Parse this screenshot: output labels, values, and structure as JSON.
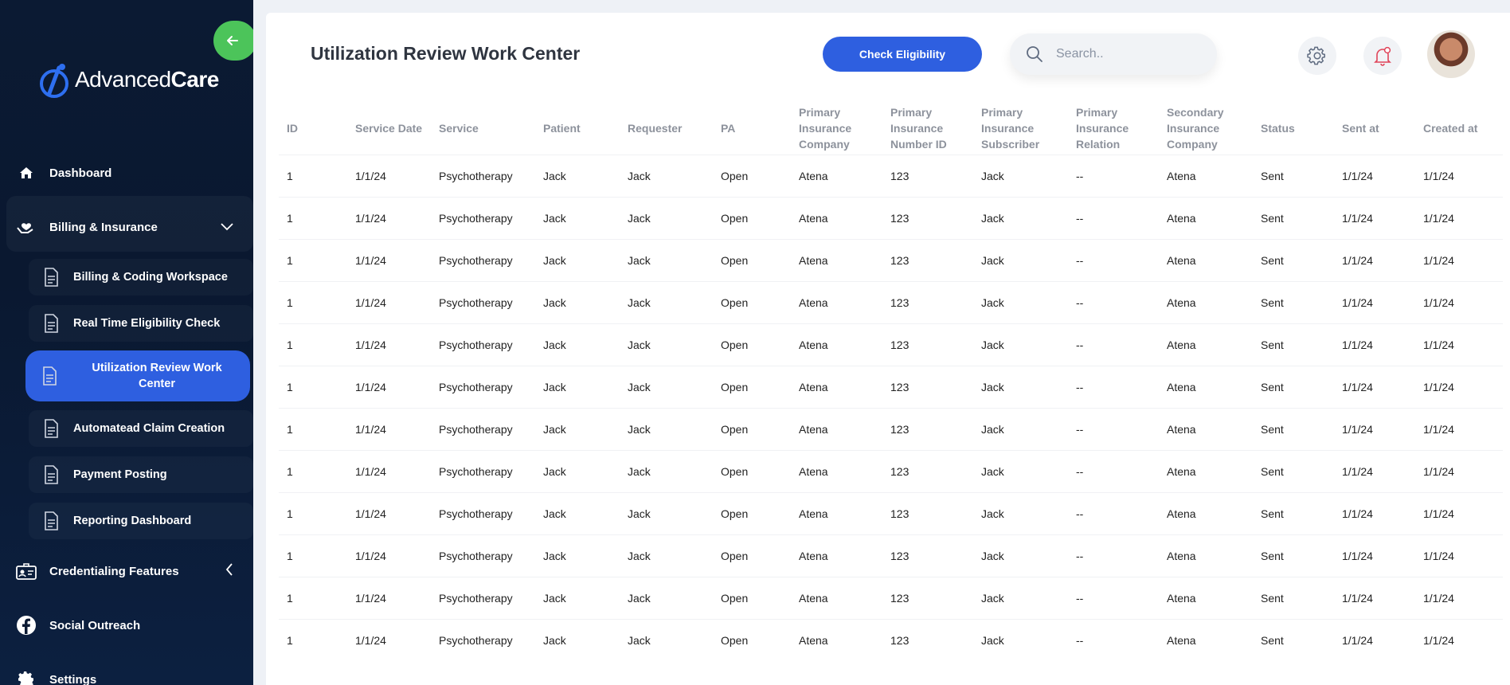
{
  "brand": {
    "name_regular": "Advanced",
    "name_bold": "Care"
  },
  "sidebar": {
    "items": [
      {
        "label": "Dashboard",
        "icon": "home-icon"
      },
      {
        "label": "Billing & Insurance",
        "icon": "hand-heart-icon"
      },
      {
        "label": "Credentialing Features",
        "icon": "id-card-icon"
      },
      {
        "label": "Social Outreach",
        "icon": "facebook-icon"
      },
      {
        "label": "Settings",
        "icon": "gear-icon"
      }
    ],
    "billing_subitems": [
      {
        "label": "Billing & Coding Workspace"
      },
      {
        "label": "Real Time Eligibility Check"
      },
      {
        "label": "Utilization Review Work Center",
        "active": true
      },
      {
        "label": "Automatead Claim Creation"
      },
      {
        "label": "Payment Posting"
      },
      {
        "label": "Reporting Dashboard"
      }
    ]
  },
  "header": {
    "title": "Utilization Review Work Center",
    "check_button": "Check Eligibility",
    "search_placeholder": "Search.."
  },
  "colors": {
    "accent": "#2e5fe0",
    "collapse": "#4cc45a",
    "sidebar_bg": "#0b1a33",
    "bell": "#e0455a"
  },
  "table": {
    "headers": [
      "ID",
      "Service Date",
      "Service",
      "Patient",
      "Requester",
      "PA",
      "Primary Insurance Company",
      "Primary Insurance Number ID",
      "Primary Insurance Subscriber",
      "Primary Insurance Relation",
      "Secondary Insurance Company",
      "Status",
      "Sent at",
      "Created at"
    ],
    "rows": [
      [
        "1",
        "1/1/24",
        "Psychotherapy",
        "Jack",
        "Jack",
        "Open",
        "Atena",
        "123",
        "Jack",
        "--",
        "Atena",
        "Sent",
        "1/1/24",
        "1/1/24"
      ],
      [
        "1",
        "1/1/24",
        "Psychotherapy",
        "Jack",
        "Jack",
        "Open",
        "Atena",
        "123",
        "Jack",
        "--",
        "Atena",
        "Sent",
        "1/1/24",
        "1/1/24"
      ],
      [
        "1",
        "1/1/24",
        "Psychotherapy",
        "Jack",
        "Jack",
        "Open",
        "Atena",
        "123",
        "Jack",
        "--",
        "Atena",
        "Sent",
        "1/1/24",
        "1/1/24"
      ],
      [
        "1",
        "1/1/24",
        "Psychotherapy",
        "Jack",
        "Jack",
        "Open",
        "Atena",
        "123",
        "Jack",
        "--",
        "Atena",
        "Sent",
        "1/1/24",
        "1/1/24"
      ],
      [
        "1",
        "1/1/24",
        "Psychotherapy",
        "Jack",
        "Jack",
        "Open",
        "Atena",
        "123",
        "Jack",
        "--",
        "Atena",
        "Sent",
        "1/1/24",
        "1/1/24"
      ],
      [
        "1",
        "1/1/24",
        "Psychotherapy",
        "Jack",
        "Jack",
        "Open",
        "Atena",
        "123",
        "Jack",
        "--",
        "Atena",
        "Sent",
        "1/1/24",
        "1/1/24"
      ],
      [
        "1",
        "1/1/24",
        "Psychotherapy",
        "Jack",
        "Jack",
        "Open",
        "Atena",
        "123",
        "Jack",
        "--",
        "Atena",
        "Sent",
        "1/1/24",
        "1/1/24"
      ],
      [
        "1",
        "1/1/24",
        "Psychotherapy",
        "Jack",
        "Jack",
        "Open",
        "Atena",
        "123",
        "Jack",
        "--",
        "Atena",
        "Sent",
        "1/1/24",
        "1/1/24"
      ],
      [
        "1",
        "1/1/24",
        "Psychotherapy",
        "Jack",
        "Jack",
        "Open",
        "Atena",
        "123",
        "Jack",
        "--",
        "Atena",
        "Sent",
        "1/1/24",
        "1/1/24"
      ],
      [
        "1",
        "1/1/24",
        "Psychotherapy",
        "Jack",
        "Jack",
        "Open",
        "Atena",
        "123",
        "Jack",
        "--",
        "Atena",
        "Sent",
        "1/1/24",
        "1/1/24"
      ],
      [
        "1",
        "1/1/24",
        "Psychotherapy",
        "Jack",
        "Jack",
        "Open",
        "Atena",
        "123",
        "Jack",
        "--",
        "Atena",
        "Sent",
        "1/1/24",
        "1/1/24"
      ],
      [
        "1",
        "1/1/24",
        "Psychotherapy",
        "Jack",
        "Jack",
        "Open",
        "Atena",
        "123",
        "Jack",
        "--",
        "Atena",
        "Sent",
        "1/1/24",
        "1/1/24"
      ]
    ]
  }
}
